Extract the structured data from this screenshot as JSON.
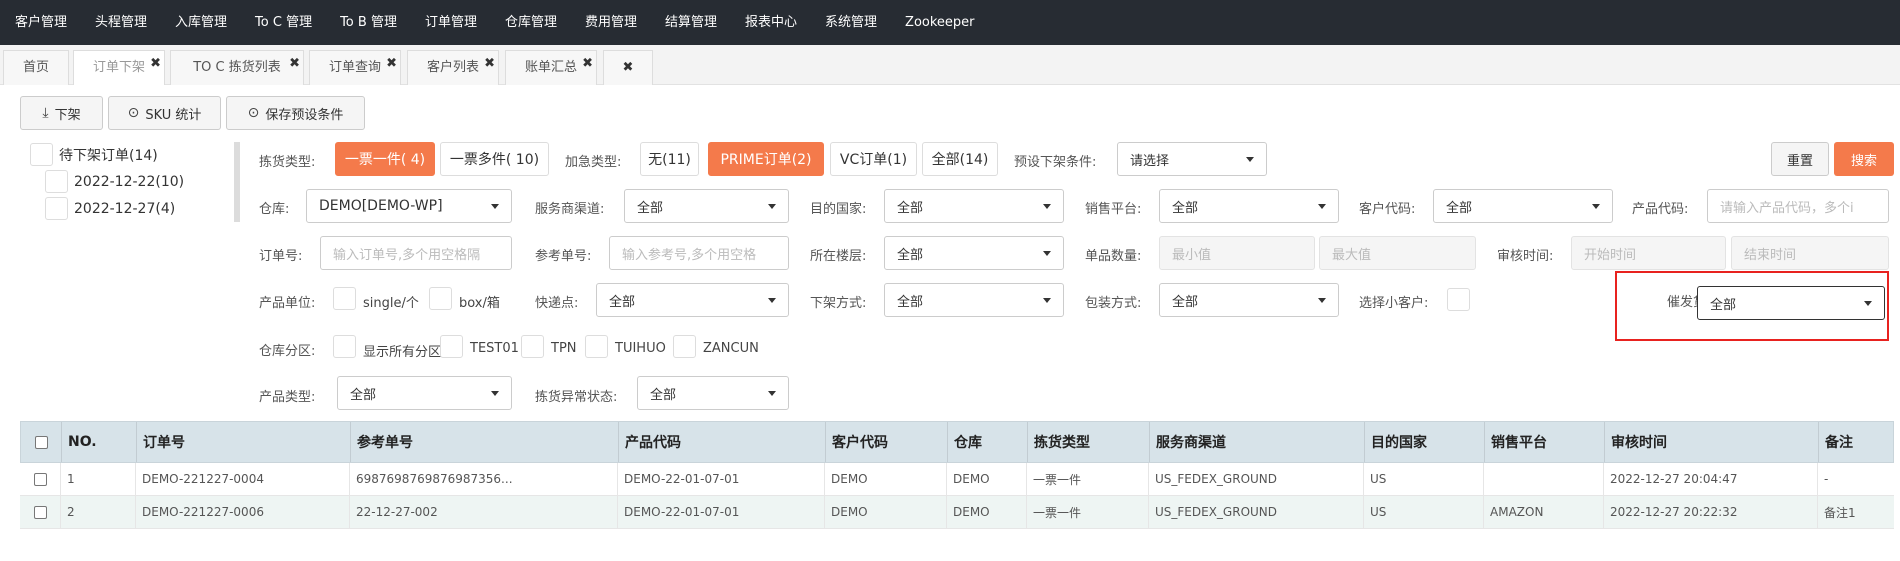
{
  "topnav": [
    "客户管理",
    "头程管理",
    "入库管理",
    "To C 管理",
    "To B 管理",
    "订单管理",
    "仓库管理",
    "费用管理",
    "结算管理",
    "报表中心",
    "系统管理",
    "Zookeeper"
  ],
  "tabs": [
    {
      "label": "首页",
      "closable": false
    },
    {
      "label": "订单下架",
      "closable": true
    },
    {
      "label": "TO C 拣货列表",
      "closable": true
    },
    {
      "label": "订单查询",
      "closable": true
    },
    {
      "label": "客户列表",
      "closable": true
    },
    {
      "label": "账单汇总",
      "closable": true
    }
  ],
  "tab_close_all": "✖",
  "tab_close_glyph": "✖",
  "toolbar": {
    "offshelf": "下架",
    "sku_stats": "SKU 统计",
    "save_preset": "保存预设条件"
  },
  "tree": {
    "root": "待下架订单(14)",
    "children": [
      "2022-12-22(10)",
      "2022-12-27(4)"
    ]
  },
  "filters": {
    "pick_type_label": "拣货类型:",
    "pick_types": [
      "一票一件( 4)",
      "一票多件( 10)"
    ],
    "urgent_label": "加急类型:",
    "urgent_types": [
      "无(11)",
      "PRIME订单(2)",
      "VC订单(1)",
      "全部(14)"
    ],
    "preset_label": "预设下架条件:",
    "preset_value": "请选择",
    "warehouse_label": "仓库:",
    "warehouse_value": "DEMO[DEMO-WP]",
    "channel_label": "服务商渠道:",
    "channel_value": "全部",
    "country_label": "目的国家:",
    "country_value": "全部",
    "platform_label": "销售平台:",
    "platform_value": "全部",
    "customer_label": "客户代码:",
    "customer_value": "全部",
    "product_code_label": "产品代码:",
    "product_code_placeholder": "请输入产品代码，多个i",
    "order_no_label": "订单号:",
    "order_no_placeholder": "输入订单号,多个用空格隔",
    "ref_no_label": "参考单号:",
    "ref_no_placeholder": "输入参考号,多个用空格",
    "floor_label": "所在楼层:",
    "floor_value": "全部",
    "qty_label": "单品数量:",
    "qty_min_placeholder": "最小值",
    "qty_max_placeholder": "最大值",
    "audit_label": "审核时间:",
    "audit_start_placeholder": "开始时间",
    "audit_end_placeholder": "结束时间",
    "unit_label": "产品单位:",
    "unit_options": [
      "single/个",
      "box/箱"
    ],
    "express_label": "快递点:",
    "express_value": "全部",
    "offshelf_mode_label": "下架方式:",
    "offshelf_mode_value": "全部",
    "pack_label": "包装方式:",
    "pack_value": "全部",
    "small_customer_label": "选择小客户:",
    "urge_label": "催发货:",
    "urge_value": "全部",
    "zone_label": "仓库分区:",
    "zone_options": [
      "显示所有分区",
      "TEST01",
      "TPN",
      "TUIHUO",
      "ZANCUN"
    ],
    "product_type_label": "产品类型:",
    "product_type_value": "全部",
    "pick_exception_label": "拣货异常状态:",
    "pick_exception_value": "全部"
  },
  "buttons": {
    "reset": "重置",
    "search": "搜索"
  },
  "table": {
    "headers": [
      "NO.",
      "订单号",
      "参考单号",
      "产品代码",
      "客户代码",
      "仓库",
      "拣货类型",
      "服务商渠道",
      "目的国家",
      "销售平台",
      "审核时间",
      "备注"
    ],
    "rows": [
      [
        "1",
        "DEMO-221227-0004",
        "6987698769876987356...",
        "DEMO-22-01-07-01",
        "DEMO",
        "DEMO",
        "一票一件",
        "US_FEDEX_GROUND",
        "US",
        "",
        "2022-12-27 20:04:47",
        "-"
      ],
      [
        "2",
        "DEMO-221227-0006",
        "22-12-27-002",
        "DEMO-22-01-07-01",
        "DEMO",
        "DEMO",
        "一票一件",
        "US_FEDEX_GROUND",
        "US",
        "AMAZON",
        "2022-12-27 20:22:32",
        "备注1"
      ]
    ]
  },
  "colors": {
    "accent": "#f47a4b",
    "topnav_bg": "#272c33",
    "highlight": "#e8221f",
    "grid_head": "#d7e3e9"
  }
}
